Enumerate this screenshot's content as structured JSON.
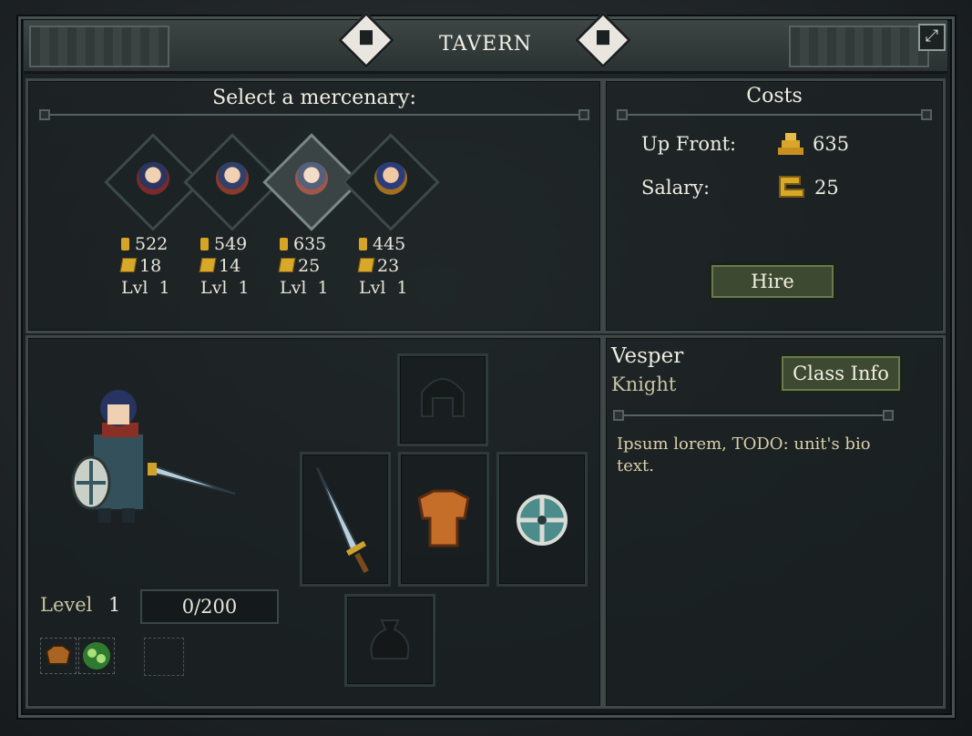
{
  "window": {
    "title": "TAVERN",
    "close_icon": "expand-icon"
  },
  "select_panel": {
    "title": "Select a mercenary:",
    "mercenaries": [
      {
        "cost": "522",
        "salary": "18",
        "level_label": "Lvl",
        "level": "1"
      },
      {
        "cost": "549",
        "salary": "14",
        "level_label": "Lvl",
        "level": "1"
      },
      {
        "cost": "635",
        "salary": "25",
        "level_label": "Lvl",
        "level": "1"
      },
      {
        "cost": "445",
        "salary": "23",
        "level_label": "Lvl",
        "level": "1"
      }
    ]
  },
  "costs_panel": {
    "title": "Costs",
    "up_front_label": "Up Front:",
    "up_front_value": "635",
    "salary_label": "Salary:",
    "salary_value": "25",
    "hire_button": "Hire"
  },
  "unit": {
    "name": "Vesper",
    "class": "Knight",
    "class_info_button": "Class Info",
    "bio": "Ipsum lorem, TODO: unit's bio text.",
    "level_label": "Level",
    "level": "1",
    "xp": "0/200"
  },
  "colors": {
    "accent_gold": "#d6a526",
    "button_green": "#3d4931",
    "class_text": "#c7c3a1"
  }
}
